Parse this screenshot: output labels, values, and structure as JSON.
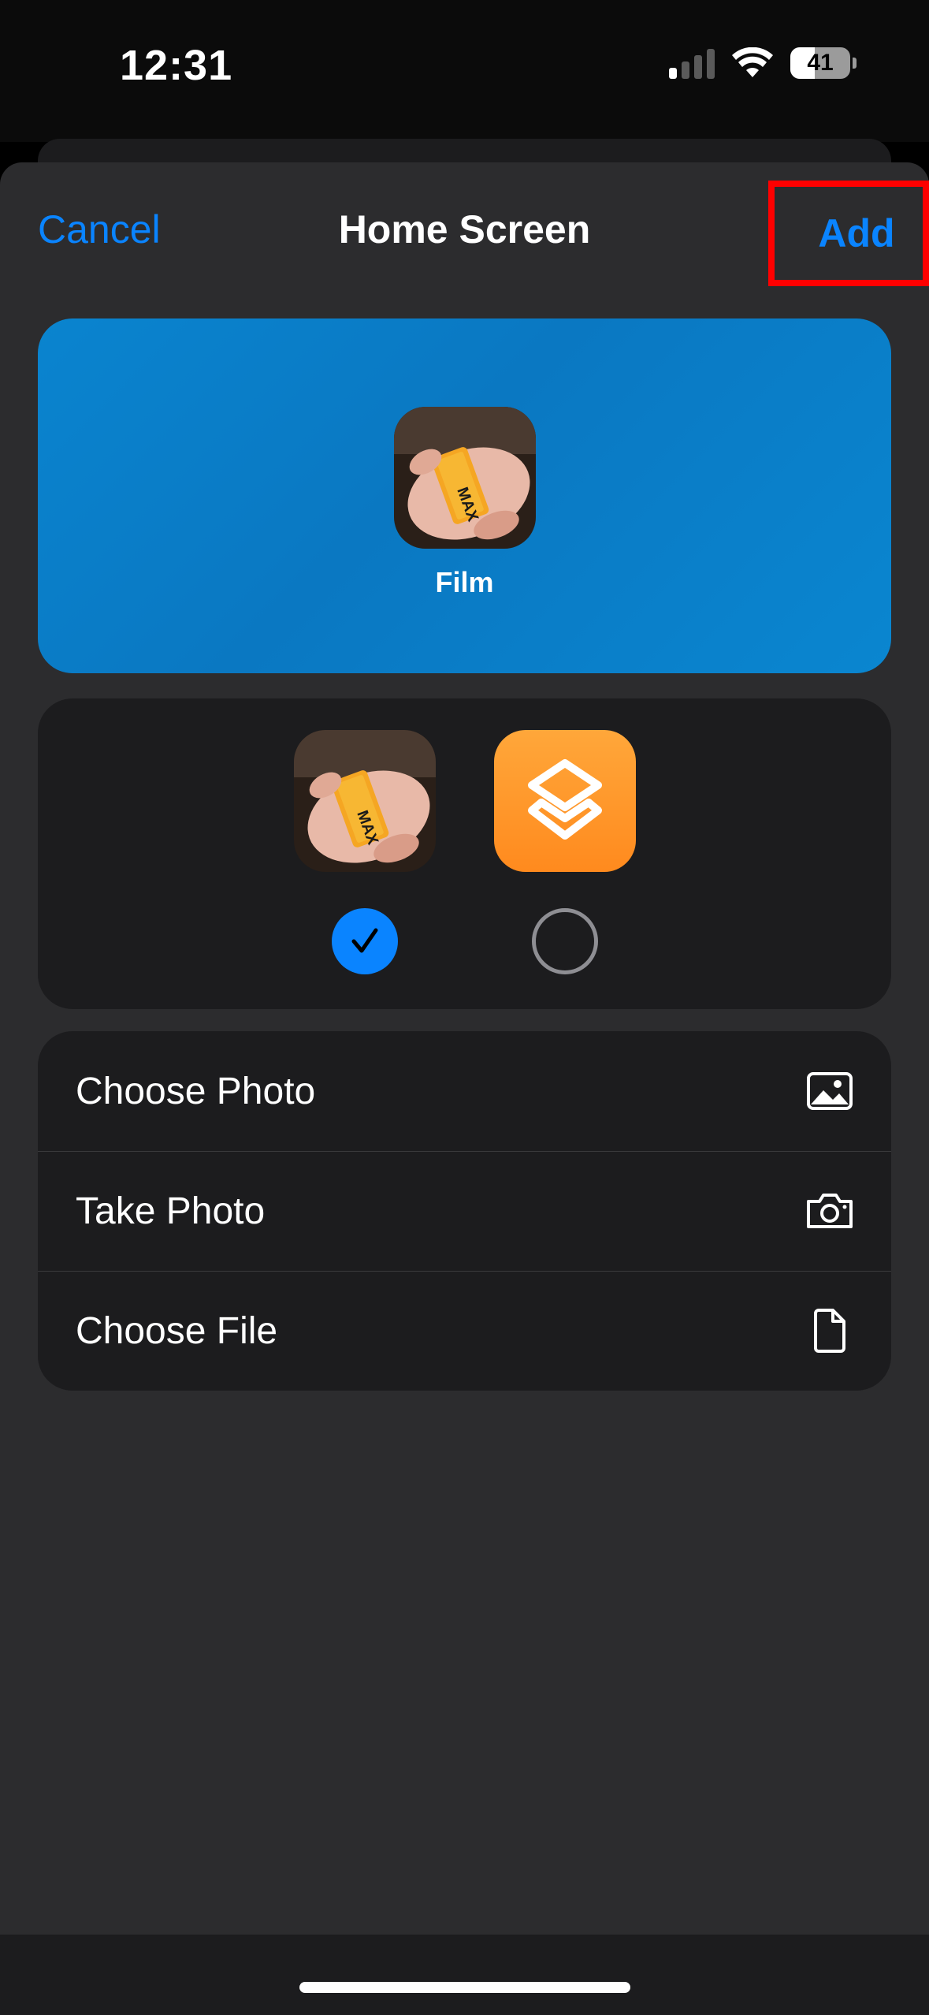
{
  "status_bar": {
    "time": "12:31",
    "battery_percent": "41",
    "signal_bars_active": 1,
    "icons": [
      "cellular-signal-icon",
      "wifi-icon",
      "battery-icon"
    ]
  },
  "nav": {
    "cancel_label": "Cancel",
    "title": "Home Screen",
    "add_label": "Add"
  },
  "preview": {
    "app_name": "Film",
    "background_color": "#0a80c8"
  },
  "icon_options": [
    {
      "name": "custom-photo",
      "selected": true
    },
    {
      "name": "shortcuts-default",
      "selected": false,
      "color": "#ff9a2e"
    }
  ],
  "actions": [
    {
      "label": "Choose Photo",
      "icon": "photo-icon"
    },
    {
      "label": "Take Photo",
      "icon": "camera-icon"
    },
    {
      "label": "Choose File",
      "icon": "document-icon"
    }
  ],
  "colors": {
    "accent": "#0a84ff",
    "sheet_bg": "#2c2c2e",
    "card_bg": "#1c1c1e",
    "highlight_box": "#ff0000"
  }
}
